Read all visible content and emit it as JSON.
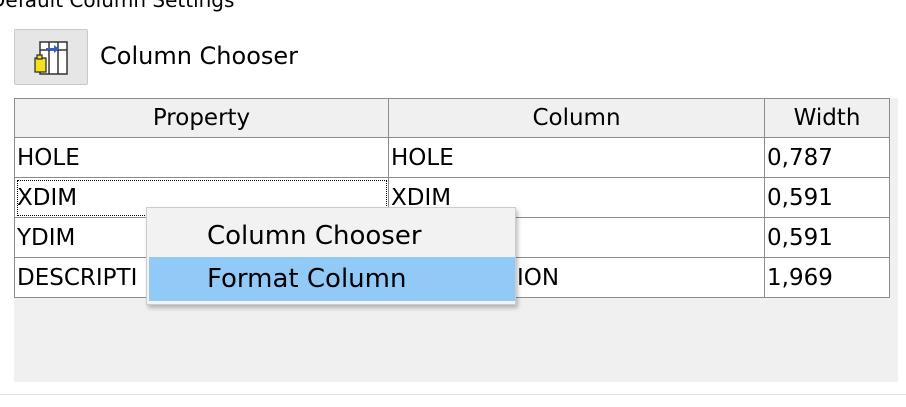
{
  "section_title": "Default Column Settings",
  "toolbar": {
    "column_chooser_label": "Column Chooser",
    "column_chooser_icon": "column-chooser-icon"
  },
  "grid": {
    "columns": [
      "Property",
      "Column",
      "Width"
    ],
    "rows": [
      {
        "property": "HOLE",
        "column": "HOLE",
        "width": "0,787"
      },
      {
        "property": "XDIM",
        "column": "XDIM",
        "width": "0,591"
      },
      {
        "property": "YDIM",
        "column": "",
        "width": "0,591"
      },
      {
        "property": "DESCRIPTI",
        "column": "ION",
        "width": "1,969"
      }
    ]
  },
  "context_menu": {
    "items": [
      {
        "label": "Column Chooser",
        "highlighted": false
      },
      {
        "label": "Format Column",
        "highlighted": true
      }
    ],
    "highlight_color": "#91c9f7"
  }
}
